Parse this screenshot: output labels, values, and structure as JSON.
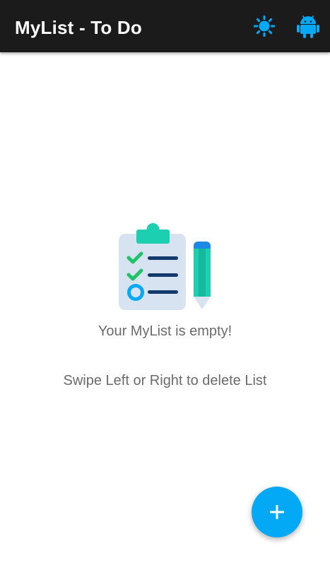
{
  "app_bar": {
    "title": "MyList - To Do",
    "background_color": "#1b1b1b",
    "actions": [
      {
        "icon": "brightness-icon",
        "color": "#03a9f4"
      },
      {
        "icon": "android-icon",
        "color": "#03a9f4"
      }
    ]
  },
  "empty_state": {
    "illustration_icon": "clipboard-checklist-pencil-icon",
    "title": "Your MyList is empty!",
    "hint": "Swipe Left or Right to delete List"
  },
  "fab": {
    "icon": "plus-icon",
    "color": "#03a9f4"
  }
}
